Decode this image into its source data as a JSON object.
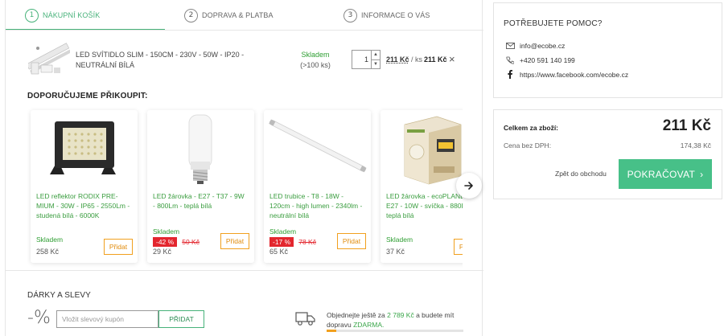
{
  "steps": [
    {
      "num": "1",
      "label": "NÁKUPNÍ KOŠÍK"
    },
    {
      "num": "2",
      "label": "DOPRAVA & PLATBA"
    },
    {
      "num": "3",
      "label": "INFORMACE O VÁS"
    }
  ],
  "cart": {
    "item_name": "LED SVÍTIDLO SLIM - 150CM - 230V - 50W - IP20 - NEUTRÁLNÍ BÍLÁ",
    "stock": "Skladem",
    "stock_qty": "(>100 ks)",
    "quantity": "1",
    "unit_price": "211 Kč",
    "unit_suffix": " / ks",
    "total_price": "211 Kč",
    "remove_icon": "×"
  },
  "recommend": {
    "title": "DOPORUČUJEME PŘIKOUPIT:",
    "products": [
      {
        "name": "LED reflektor RODIX PRE-MIUM - 30W - IP65 - 2550Lm - studená bílá - 6000K",
        "stock": "Skladem",
        "discount": "",
        "old_price": "",
        "price": "258 Kč",
        "buy": "Přidat"
      },
      {
        "name": "LED žárovka - E27 - T37 - 9W - 800Lm - teplá bílá",
        "stock": "Skladem",
        "discount": "-42 %",
        "old_price": "50 Kč",
        "price": "29 Kč",
        "buy": "Přidat"
      },
      {
        "name": "LED trubice - T8 - 18W - 120cm - high lumen - 2340lm - neutrální bílá",
        "stock": "Skladem",
        "discount": "-17 %",
        "old_price": "78 Kč",
        "price": "65 Kč",
        "buy": "Přidat"
      },
      {
        "name": "LED žárovka - ecoPLANET - E27 - 10W - svíčka - 880Lm - teplá bílá",
        "stock": "Skladem",
        "discount": "",
        "old_price": "",
        "price": "37 Kč",
        "buy": "Přidat"
      }
    ],
    "next_icon": "arrow-right-icon"
  },
  "gifts": {
    "title": "DÁRKY A SLEVY",
    "percent": "-%",
    "coupon_placeholder": "Vložit slevový kupón",
    "apply_label": "PŘIDAT"
  },
  "shipping": {
    "text_before": "Objednejte ještě za ",
    "amount": "2 789 Kč",
    "text_middle": " a budete mít dopravu ",
    "free": "ZDARMA.",
    "progress": 0.07
  },
  "help": {
    "title": "POTŘEBUJETE POMOC?",
    "email": "info@ecobe.cz",
    "phone": "+420 591 140 199",
    "facebook": "https://www.facebook.com/ecobe.cz"
  },
  "summary": {
    "total_label": "Celkem za zboží:",
    "total_value": "211 Kč",
    "vat_label": "Cena bez DPH:",
    "vat_value": "174,38 Kč",
    "back_label": "Zpět do obchodu",
    "continue_label": "POKRAČOVAT"
  },
  "colors": {
    "accent_green": "#47b27a",
    "button_green": "#47c088",
    "orange": "#f1a01e",
    "discount_red": "#e3262e"
  }
}
